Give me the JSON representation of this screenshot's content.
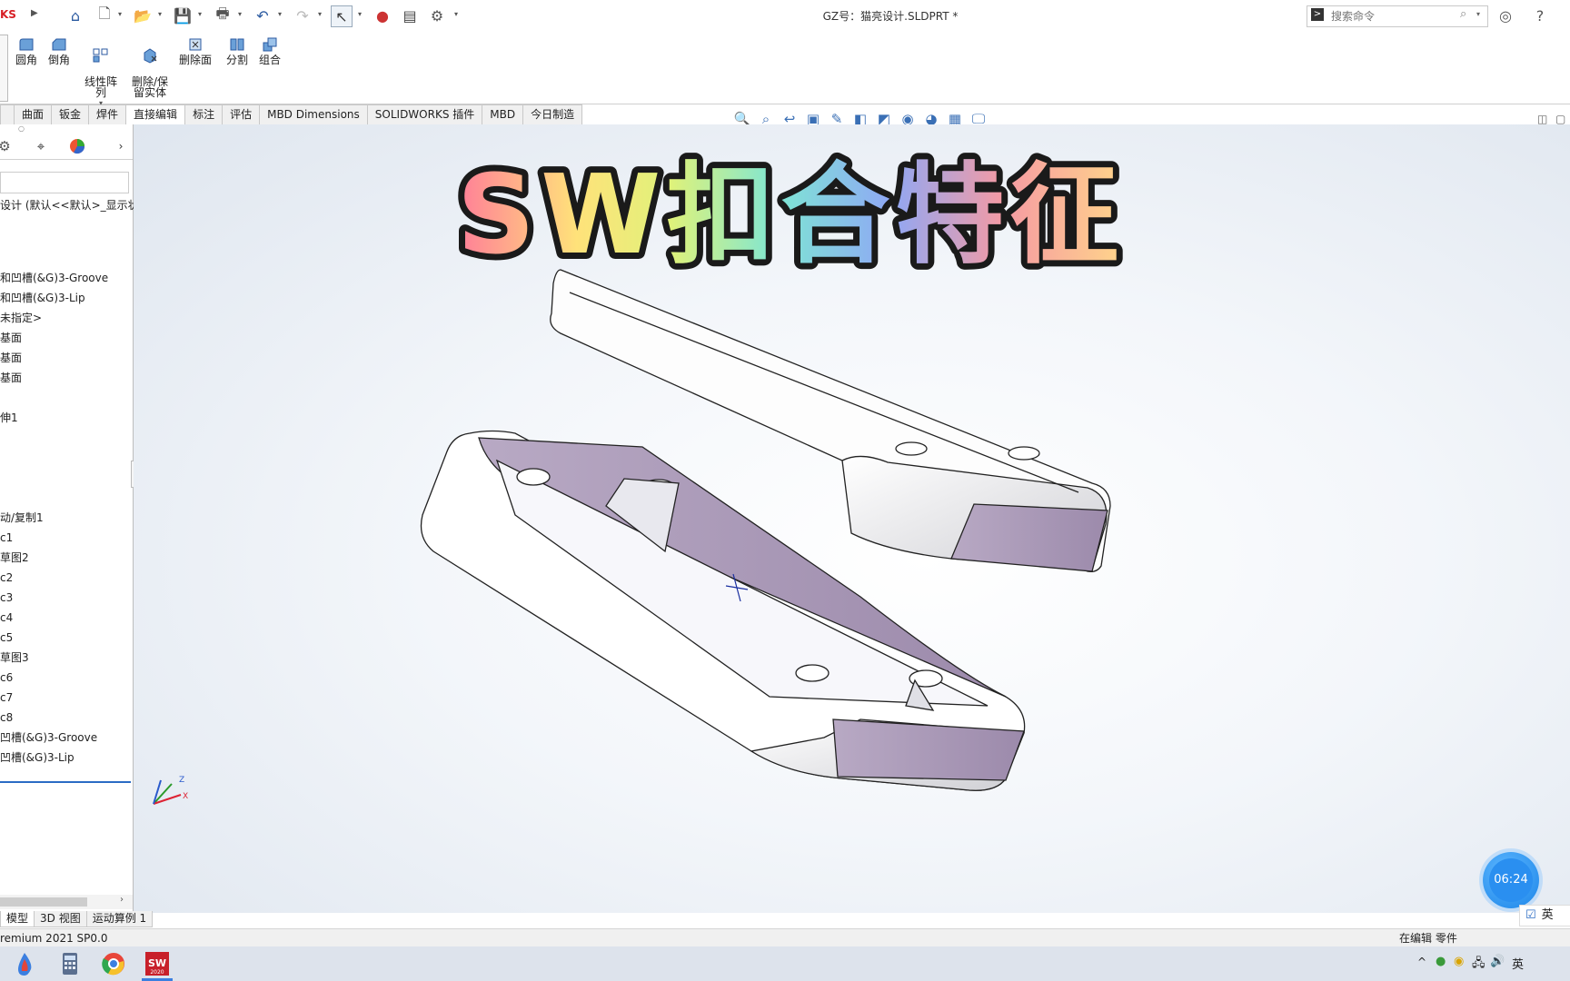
{
  "titlebar": {
    "logo_text": "KS",
    "document_title": "GZ号：猫亮设计.SLDPRT *",
    "search_placeholder": "搜索命令"
  },
  "ribbon": {
    "buttons": [
      {
        "label": "圆角",
        "icon": "fillet-icon"
      },
      {
        "label": "倒角",
        "icon": "chamfer-icon"
      },
      {
        "label": "线性阵\n列",
        "icon": "linear-pattern-icon"
      },
      {
        "label": "删除/保\n留实体",
        "icon": "delete-keep-body-icon"
      },
      {
        "label": "删除面",
        "icon": "delete-face-icon"
      },
      {
        "label": "分割",
        "icon": "split-icon"
      },
      {
        "label": "组合",
        "icon": "combine-icon"
      }
    ]
  },
  "tabs": [
    "",
    "曲面",
    "钣金",
    "焊件",
    "直接编辑",
    "标注",
    "评估",
    "MBD Dimensions",
    "SOLIDWORKS 插件",
    "MBD",
    "今日制造"
  ],
  "active_tab_index": 4,
  "feature_tree": {
    "root": "设计  (默认<<默认>_显示状",
    "items": [
      {
        "label": "和凹槽(&G)3-Groove",
        "row": 0
      },
      {
        "label": "和凹槽(&G)3-Lip",
        "row": 1
      },
      {
        "label": "未指定>",
        "row": 2
      },
      {
        "label": "基面",
        "row": 3
      },
      {
        "label": "基面",
        "row": 4
      },
      {
        "label": "基面",
        "row": 5
      },
      {
        "label": "伸1",
        "row": 7
      },
      {
        "label": "动/复制1",
        "row": 12
      },
      {
        "label": "c1",
        "row": 13
      },
      {
        "label": "草图2",
        "row": 14
      },
      {
        "label": "c2",
        "row": 15
      },
      {
        "label": "c3",
        "row": 16
      },
      {
        "label": "c4",
        "row": 17
      },
      {
        "label": "c5",
        "row": 18
      },
      {
        "label": "草图3",
        "row": 19
      },
      {
        "label": "c6",
        "row": 20
      },
      {
        "label": "c7",
        "row": 21
      },
      {
        "label": "c8",
        "row": 22
      },
      {
        "label": "凹槽(&G)3-Groove",
        "row": 23
      },
      {
        "label": "凹槽(&G)3-Lip",
        "row": 24
      }
    ]
  },
  "overlay_title": "SW扣合特征",
  "bottom_tabs": [
    "模型",
    "3D 视图",
    "运动算例 1"
  ],
  "status": {
    "left": "remium 2021 SP0.0",
    "right": "在编辑 零件"
  },
  "timer": "06:24",
  "ime": "英",
  "colors": {
    "accent": "#2b5aa0",
    "viewport_bg": "#e4eaf2",
    "taskbar": "#dde3ec"
  }
}
